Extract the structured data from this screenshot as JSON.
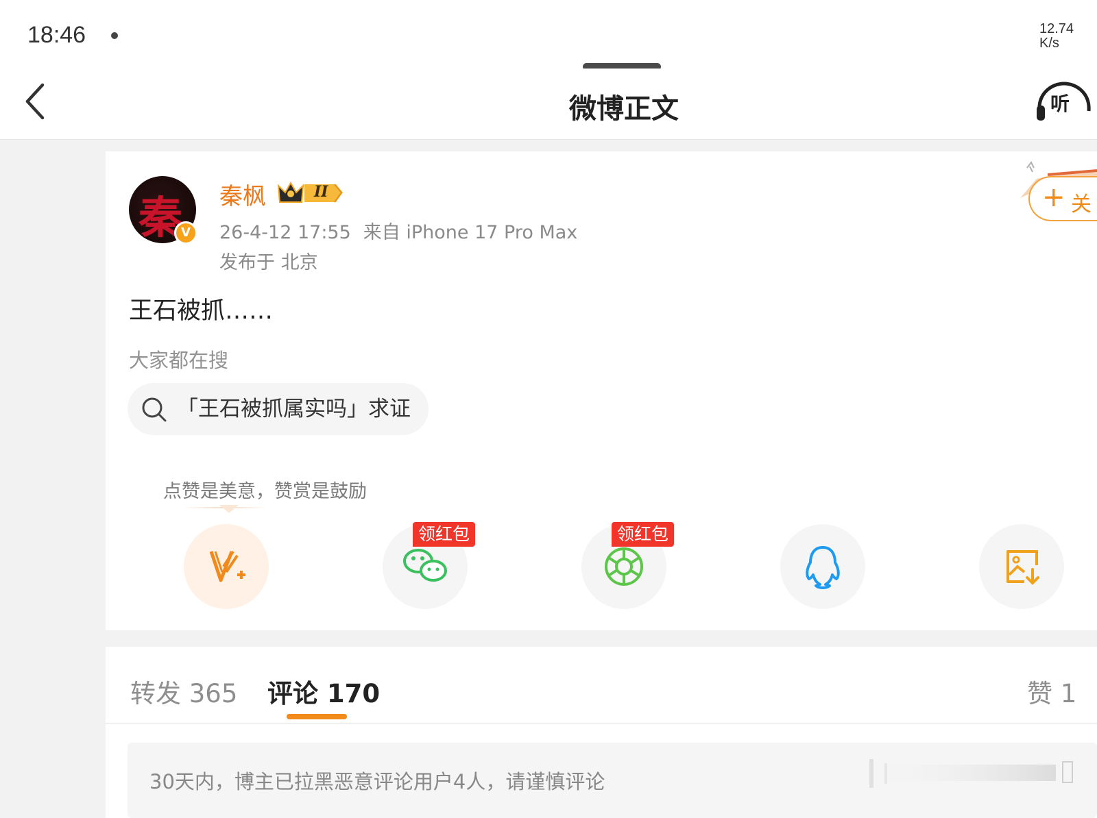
{
  "status_bar": {
    "time": "18:46",
    "net_speed": "12.74\nK/s"
  },
  "nav": {
    "title": "微博正文",
    "listen_label": "听"
  },
  "post": {
    "username": "秦枫",
    "avatar_char": "秦",
    "verified_badge": "V",
    "member_level": "II",
    "time": "26-4-12 17:55",
    "source": "来自 iPhone 17 Pro Max",
    "location": "发布于 北京",
    "follow_label": "关",
    "text": "王石被抓……",
    "search_hint": "大家都在搜",
    "search_query": "「王石被抓属实吗」求证",
    "reward_tip": "点赞是美意，赞赏是鼓励"
  },
  "share_actions": [
    {
      "icon": "reward-v-plus-icon"
    },
    {
      "icon": "wechat-icon",
      "badge": "领红包"
    },
    {
      "icon": "moments-icon",
      "badge": "领红包"
    },
    {
      "icon": "qq-icon"
    },
    {
      "icon": "save-image-icon"
    }
  ],
  "tabs": {
    "repost": "转发 365",
    "comment": "评论 170",
    "like": "赞 1"
  },
  "notice": "30天内，博主已拉黑恶意评论用户4人，请谨慎评论",
  "colors": {
    "accent": "#f28a1c",
    "username": "#ec7a1b",
    "redpack": "#f2352a",
    "wechat": "#3bc05f",
    "qq": "#1e9bf0"
  }
}
